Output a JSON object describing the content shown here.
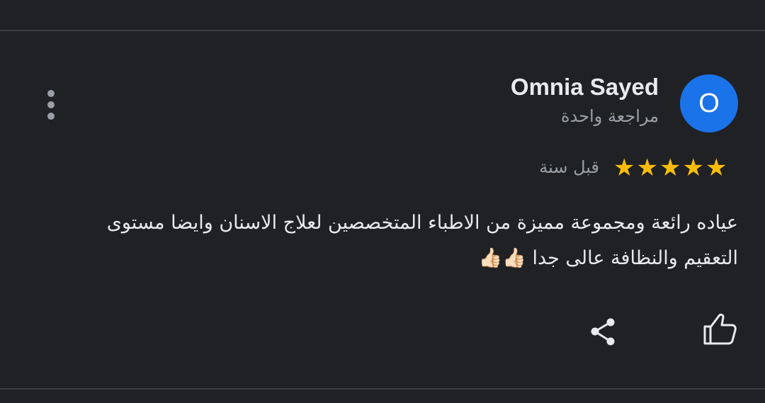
{
  "reviewer": {
    "name": "Omnia Sayed",
    "initial": "O",
    "avatar_color": "#1a73e8",
    "subtitle": "مراجعة واحدة"
  },
  "rating": {
    "stars": 5,
    "max": 5,
    "star_color": "#fbbc04",
    "time_ago": "قبل سنة"
  },
  "review": {
    "text": "عياده رائعة ومجموعة مميزة من الاطباء المتخصصين لعلاج الاسنان وايضا مستوى التعقيم والنظافة عالى جدا 👍🏻👍🏻"
  },
  "actions": {
    "like_icon": "thumb-up-icon",
    "share_icon": "share-icon",
    "menu_icon": "more-vert-icon"
  }
}
